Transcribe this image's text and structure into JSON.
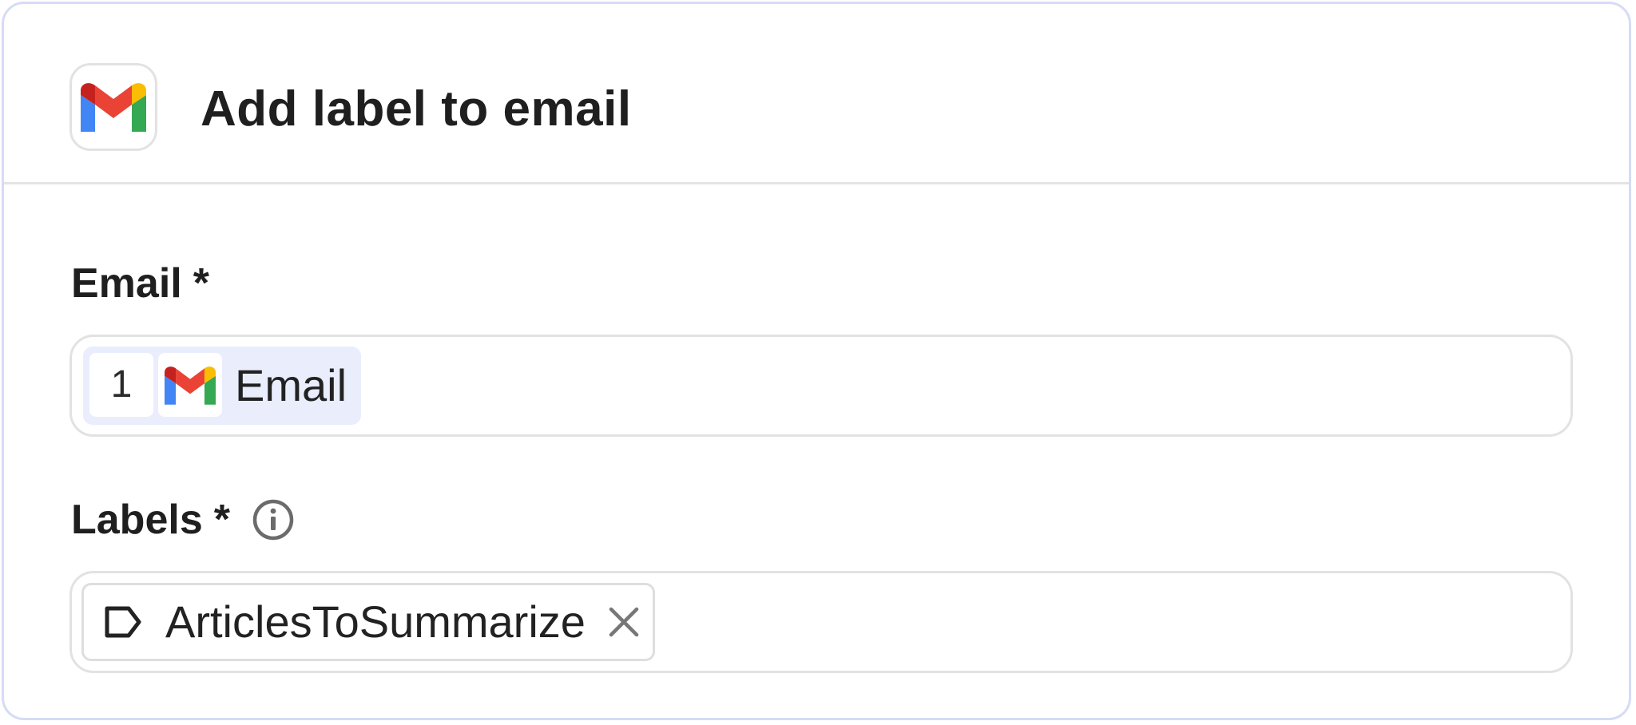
{
  "header": {
    "title": "Add label to email",
    "app_icon": "gmail-icon"
  },
  "fields": {
    "email": {
      "label": "Email",
      "required_mark": "*",
      "token": {
        "step_number": "1",
        "icon": "gmail-icon",
        "text": "Email"
      }
    },
    "labels": {
      "label": "Labels",
      "required_mark": "*",
      "info_icon": "info-icon",
      "chip": {
        "icon": "label-tag-icon",
        "text": "ArticlesToSummarize",
        "remove_icon": "close-icon"
      }
    }
  },
  "colors": {
    "card_border": "#d5dcf5",
    "divider": "#e4e4e4",
    "token_background": "#e9edfc",
    "gmail_red": "#ea4335",
    "gmail_dark_red": "#c5221f",
    "gmail_blue": "#4285f4",
    "gmail_green": "#34a853",
    "gmail_yellow": "#fbbc04"
  }
}
